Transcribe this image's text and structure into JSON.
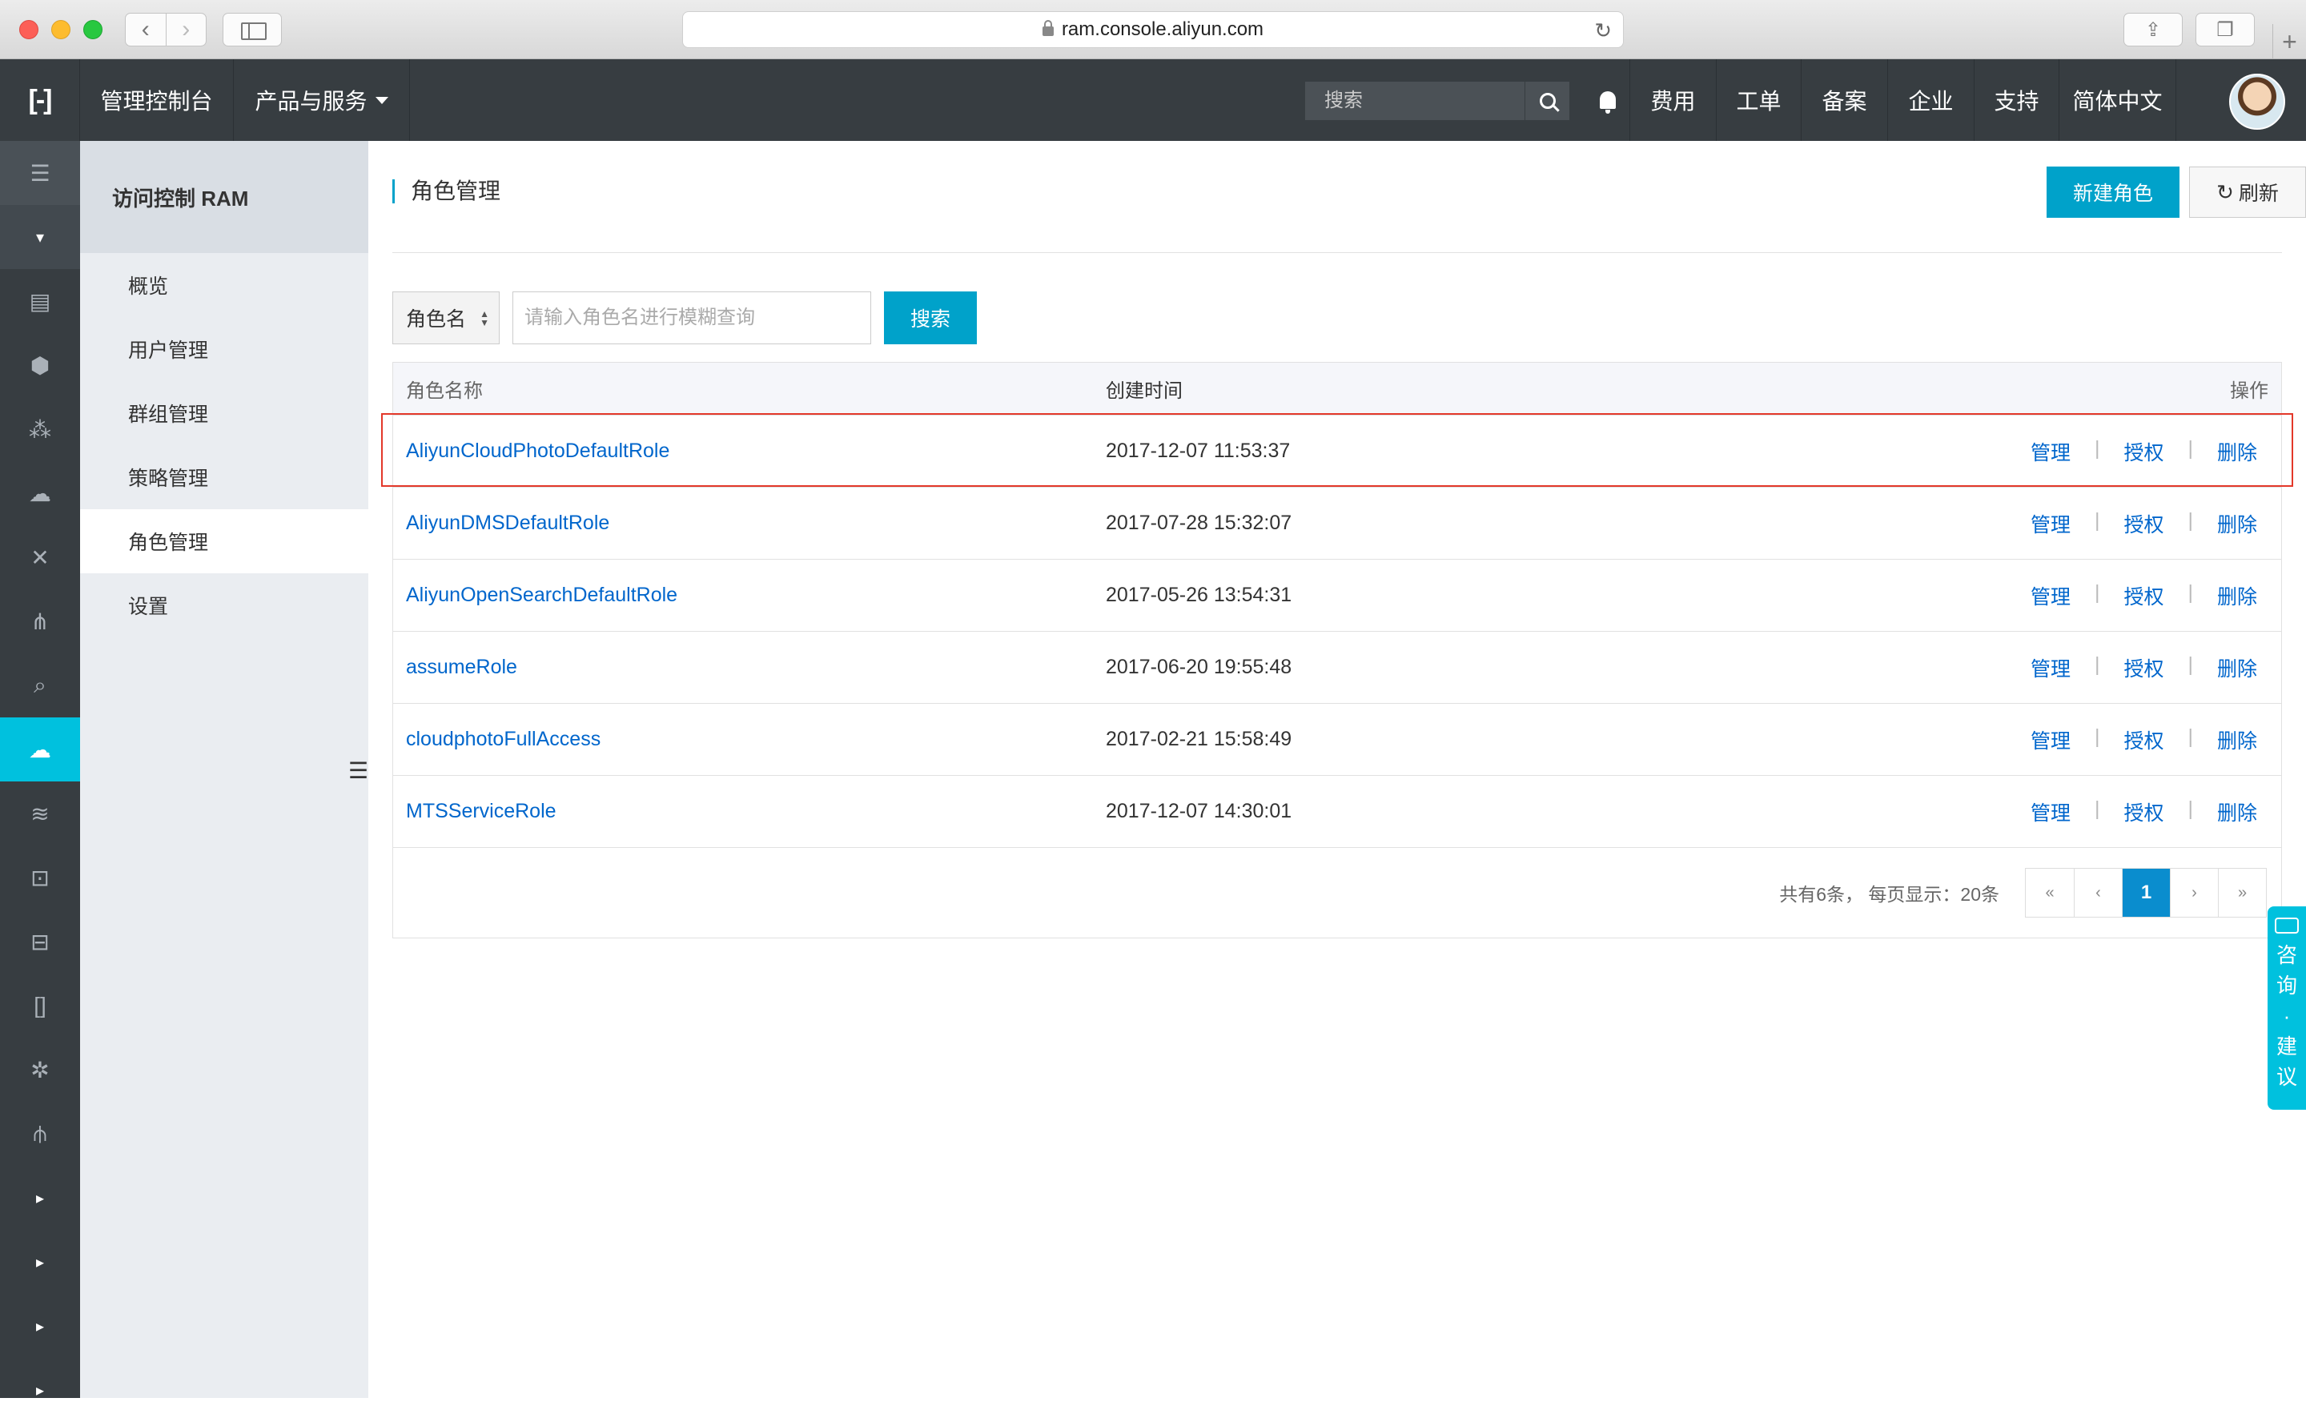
{
  "browser": {
    "url": "ram.console.aliyun.com"
  },
  "topnav": {
    "logo": "[-]",
    "console": "管理控制台",
    "products": "产品与服务",
    "search_placeholder": "搜索",
    "fee": "费用",
    "ticket": "工单",
    "record": "备案",
    "enterprise": "企业",
    "support": "支持",
    "language": "简体中文"
  },
  "sidebar": {
    "title": "访问控制 RAM",
    "items": [
      {
        "label": "概览"
      },
      {
        "label": "用户管理"
      },
      {
        "label": "群组管理"
      },
      {
        "label": "策略管理"
      },
      {
        "label": "角色管理"
      },
      {
        "label": "设置"
      }
    ],
    "active_index": 4
  },
  "page": {
    "title": "角色管理",
    "new_role_btn": "新建角色",
    "refresh_btn": "刷新"
  },
  "filter": {
    "field": "角色名",
    "placeholder": "请输入角色名进行模糊查询",
    "search_btn": "搜索"
  },
  "table": {
    "headers": {
      "name": "角色名称",
      "created": "创建时间",
      "ops": "操作"
    },
    "ops": {
      "manage": "管理",
      "grant": "授权",
      "delete": "删除"
    },
    "rows": [
      {
        "name": "AliyunCloudPhotoDefaultRole",
        "created": "2017-12-07 11:53:37"
      },
      {
        "name": "AliyunDMSDefaultRole",
        "created": "2017-07-28 15:32:07"
      },
      {
        "name": "AliyunOpenSearchDefaultRole",
        "created": "2017-05-26 13:54:31"
      },
      {
        "name": "assumeRole",
        "created": "2017-06-20 19:55:48"
      },
      {
        "name": "cloudphotoFullAccess",
        "created": "2017-02-21 15:58:49"
      },
      {
        "name": "MTSServiceRole",
        "created": "2017-12-07 14:30:01"
      }
    ]
  },
  "pagination": {
    "info": "共有6条， 每页显示：20条",
    "first": "«",
    "prev": "‹",
    "current": "1",
    "next": "›",
    "last": "»"
  },
  "feedback": {
    "chars": [
      "咨",
      "询",
      "·",
      "建",
      "议"
    ]
  },
  "colors": {
    "primary": "#00a2ca",
    "nav_bg": "#373d41",
    "active_rail": "#00c1de",
    "link": "#0066cc",
    "highlight": "#e3382a"
  }
}
